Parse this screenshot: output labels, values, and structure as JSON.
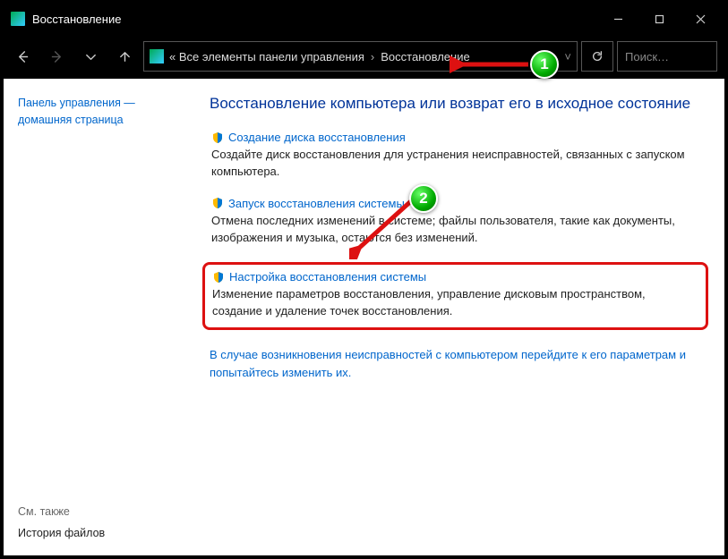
{
  "titlebar": {
    "title": "Восстановление"
  },
  "breadcrumb": {
    "root_prefix": "«",
    "level1": "Все элементы панели управления",
    "level2": "Восстановление"
  },
  "search": {
    "placeholder": "Поиск…"
  },
  "sidebar": {
    "home_link": "Панель управления — домашняя страница",
    "see_also_label": "См. также",
    "see_also_link": "История файлов"
  },
  "main": {
    "heading": "Восстановление компьютера или возврат его в исходное состояние",
    "options": [
      {
        "title": "Создание диска восстановления",
        "desc": "Создайте диск восстановления для устранения неисправностей, связанных с запуском компьютера."
      },
      {
        "title": "Запуск восстановления системы",
        "desc": "Отмена последних изменений в системе; файлы пользователя, такие как документы, изображения и музыка, остаются без изменений."
      },
      {
        "title": "Настройка восстановления системы",
        "desc": "Изменение параметров восстановления, управление дисковым пространством, создание и удаление точек восстановления."
      }
    ],
    "troubleshoot": "В случае возникновения неисправностей с компьютером перейдите к его параметрам и попытайтесь изменить их."
  },
  "annotations": {
    "badge1": "1",
    "badge2": "2"
  }
}
